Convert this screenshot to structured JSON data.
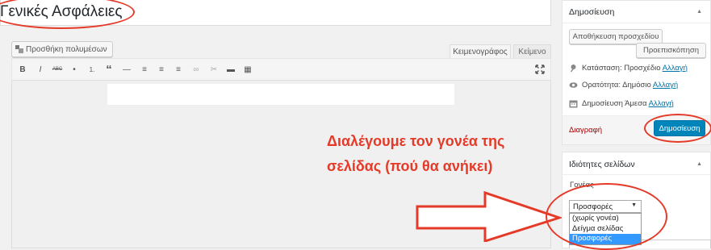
{
  "title_value": "Γενικές Ασφάλειες",
  "media_button_label": "Προσθήκη πολυμέσων",
  "editor_tabs": {
    "visual": "Κειμενογράφος",
    "text": "Κείμενο"
  },
  "toolbar": [
    "B",
    "I",
    "ABC",
    "•",
    "1.",
    "“",
    "—",
    "≡",
    "≡",
    "≡",
    "∞",
    "✂",
    "▬",
    "▦"
  ],
  "annotation": {
    "line1": "Διαλέγουμε τον γονέα της",
    "line2": "σελίδας (πού θα ανήκει)"
  },
  "publish_box": {
    "title": "Δημοσίευση",
    "save_draft": "Αποθήκευση προσχεδίου",
    "preview": "Προεπισκόπηση",
    "status_label": "Κατάσταση:",
    "status_value": "Προσχέδιο",
    "visibility_label": "Ορατότητα:",
    "visibility_value": "Δημόσιο",
    "schedule_label": "Δημοσίευση",
    "schedule_value": "Άμεσα",
    "edit_link": "Αλλαγή",
    "delete": "Διαγραφή",
    "publish": "Δημοσίευση"
  },
  "attributes_box": {
    "title": "Ιδιότητες σελίδων",
    "parent_label": "Γονέας",
    "parent_selected": "Προσφορές",
    "options": [
      "(χωρίς γονέα)",
      "Δείγμα σελίδας",
      "Προσφορές"
    ]
  },
  "colors": {
    "annotation": "#e53a28",
    "publish": "#0085ba",
    "link": "#0073aa",
    "selected": "#3399ff"
  }
}
